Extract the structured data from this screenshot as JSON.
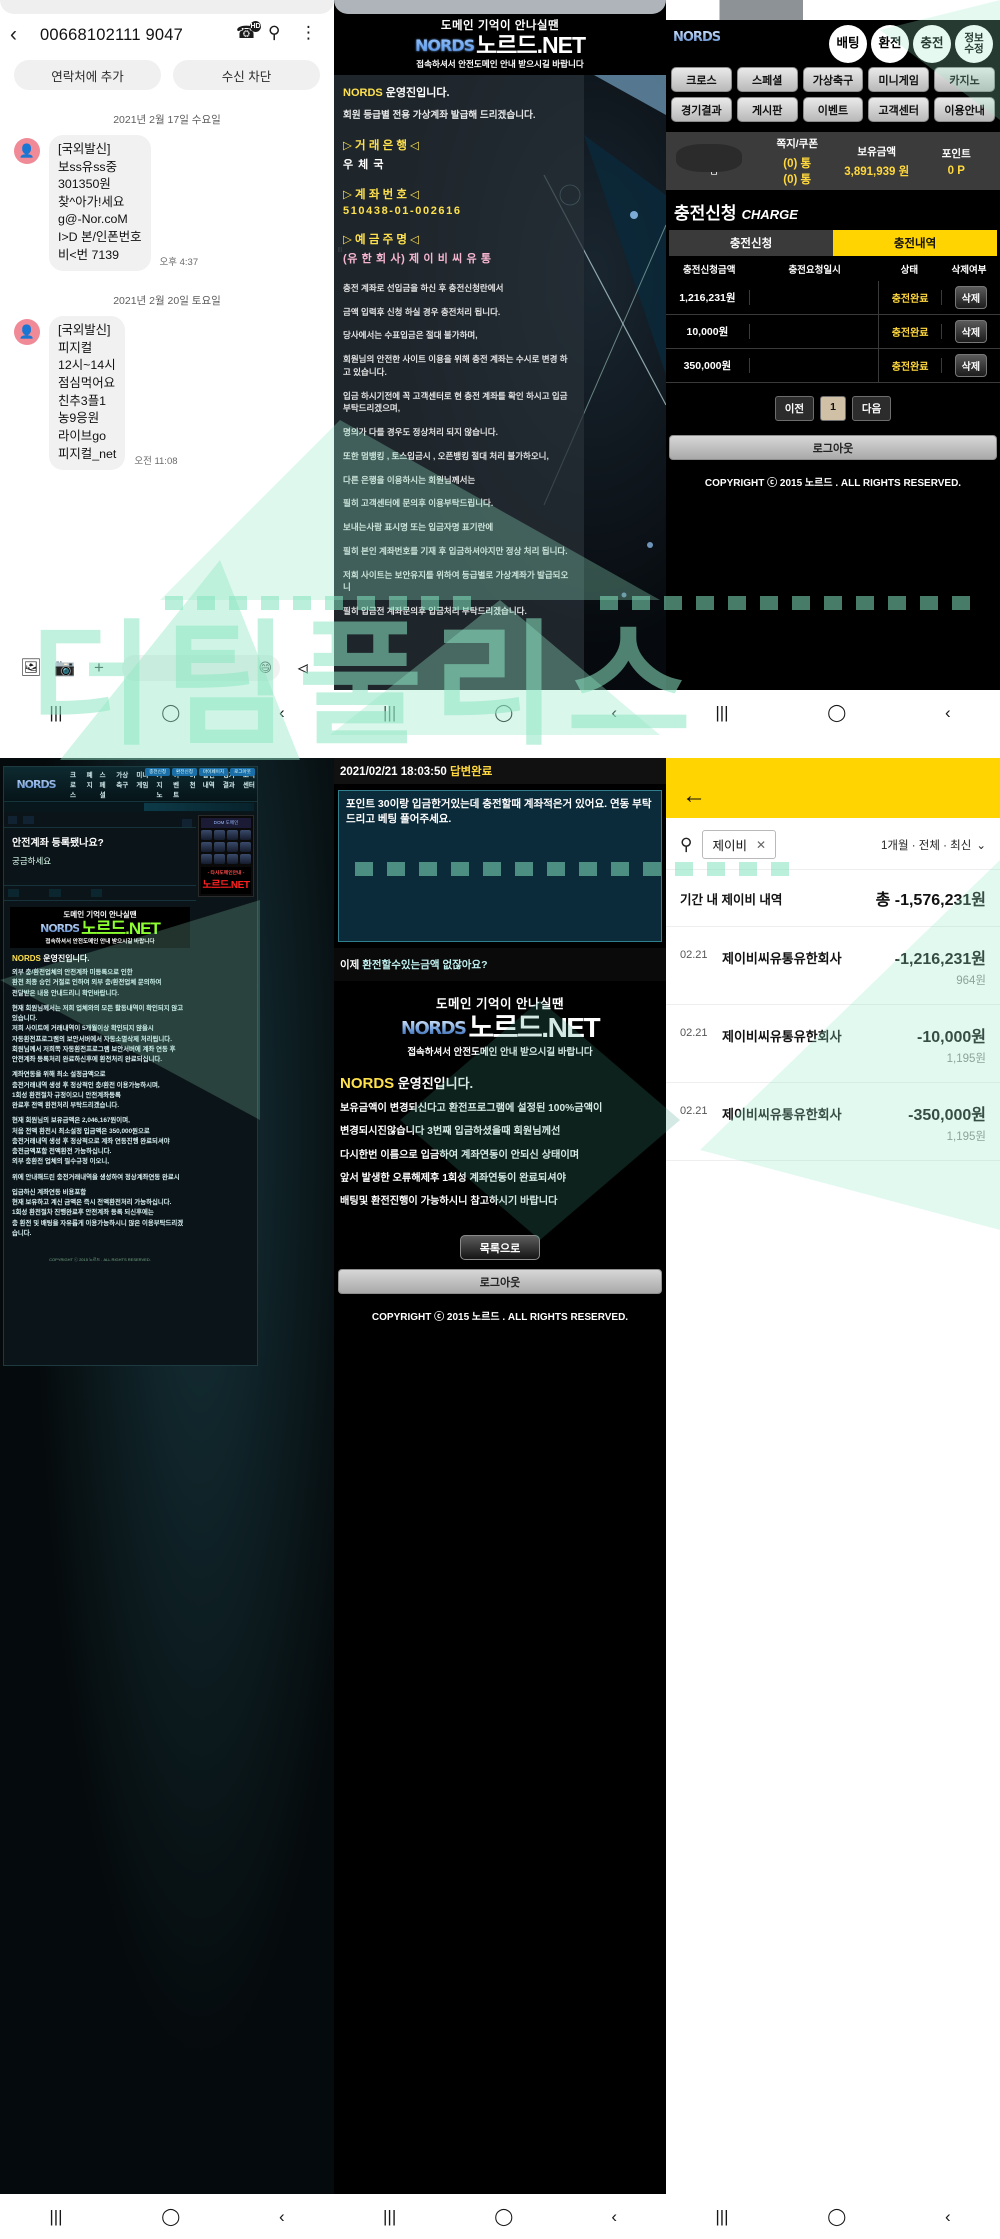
{
  "panel_sms": {
    "phone_number": "00668102111 9047",
    "call_icon": "call-hd-icon",
    "search_icon": "search-icon",
    "more_icon": "more-vertical-icon",
    "add_contact_label": "연락처에 추가",
    "block_label": "수신 차단",
    "date_1": "2021년 2월 17일 수요일",
    "date_2": "2021년 2월 20일 토요일",
    "message_1": "[국외발신]\n보ss유ss중\n301350원\n찾^아가!세요\ng@-Nor.coM\nI>D 본/인폰번호\n비<번 7139",
    "time_1": "오후 4:37",
    "message_2": "[국외발신]\n피지컬\n12시~14시\n점심먹어요\n친추3플1\n농9응원\n라이브go\n피지컬_net",
    "time_2": "오전 11:08",
    "footer_icons": [
      "image-icon",
      "camera-icon",
      "plus-icon",
      "sticker-icon",
      "voice-icon"
    ]
  },
  "panel_notice": {
    "banner_top": "도메인 기억이 안나실땐",
    "banner_logo": "NORDS",
    "banner_domain": "노르드.NET",
    "banner_bottom": "접속하셔서 안전도메인 안내 받으시길 바랍니다",
    "title_brand": "NORDS",
    "title_rest": " 운영진입니다.",
    "subtitle": "회원 등급별 전용 가상계좌 발급해 드리겠습니다.",
    "bank_label": "▷ 거 래 은 행 ◁",
    "bank_value": "우 체 국",
    "account_label": "▷ 계 좌 번 호 ◁",
    "account_value": "510438-01-002616",
    "holder_label": "▷ 예 금 주 명 ◁",
    "holder_value": "(유 한 회 사) 제 이 비 씨 유 통",
    "paragraphs": [
      "충전 계좌로 선입금을 하신 후 충전신청란에서",
      "금액 입력후 신청 하실 경우 충전처리 됩니다.",
      "당사에서는 수표입금은 절대 불가하며,",
      "회원님의 안전한 사이트 이용을 위해 충전 계좌는 수시로 변경 하고 있습니다.",
      "입금 하시기전에 꼭 고객센터로 현 충전 계좌를 확인 하시고 입금 부탁드리겠으며,",
      "명의가 다를 경우도 정상처리 되지 않습니다.",
      "또한 멈뱅킹 , 토스입금시 , 오픈뱅킹 절대 처리 불가하오니,",
      "다른 은행을 이용하시는 회원님께서는",
      "필히 고객센터에 문의후 이용부탁드립니다.",
      "보내는사람 표시명 또는 입금자명 표기란에",
      "필히 본인 계좌번호를 기재 후 입금하셔야지만 정상 처리 됩니다.",
      "저희 사이트는 보안유지를 위하여 등급별로 가상계좌가 발급되오니",
      "필히 입금전 계좌문의후 입금처리 부탁드리겠습니다."
    ]
  },
  "panel_charge": {
    "logo": "NORDS",
    "circle_buttons": [
      "배팅",
      "환전",
      "충전",
      "정보\n수정"
    ],
    "menu_row_1": [
      "크로스",
      "스페셜",
      "가상축구",
      "미니게임",
      "카지노"
    ],
    "menu_row_2": [
      "경기결과",
      "게시판",
      "이벤트",
      "고객센터",
      "이용안내"
    ],
    "user_suffix": "님",
    "info": [
      {
        "label": "쪽지/쿠폰",
        "value": "(0) 통\n(0) 통"
      },
      {
        "label": "보유금액",
        "value": "3,891,939 원"
      },
      {
        "label": "포인트",
        "value": "0 P"
      }
    ],
    "section_title_kr": "충전신청",
    "section_title_en": "CHARGE",
    "tab_request": "충전신청",
    "tab_history": "충전내역",
    "table_headers": [
      "충전신청금액",
      "충전요청일시",
      "상태",
      "삭제여부"
    ],
    "rows": [
      {
        "amount": "1,216,231원",
        "datetime": "",
        "status": "충전완료",
        "delete": "삭제"
      },
      {
        "amount": "10,000원",
        "datetime": "",
        "status": "충전완료",
        "delete": "삭제"
      },
      {
        "amount": "350,000원",
        "datetime": "",
        "status": "충전완료",
        "delete": "삭제"
      }
    ],
    "pager_prev": "이전",
    "pager_current": "1",
    "pager_next": "다음",
    "logout": "로그아웃",
    "copyright": "COPYRIGHT ⓒ 2015 노르드 . ALL RIGHTS RESERVED."
  },
  "panel_desktop": {
    "logo": "NORDS",
    "nav": [
      "크로스",
      "폐지",
      "스페셜",
      "가상축구",
      "미니게임",
      "카지노",
      "이벤트",
      "머천",
      "충전내역",
      "경기결과",
      "고객센터"
    ],
    "login_buttons": [
      "충전신청",
      "환전신청",
      "마이페이지",
      "로그아웃"
    ],
    "question_title": "안전계좌 등록됐나요?",
    "question_body": "궁금하세요",
    "banner_top": "도메인 기억이 안나실땐",
    "banner_logo": "NORDS",
    "banner_domain": "노르드.NET",
    "banner_bottom": "접속하셔서 안전도메인 안내 받으시길 바랍니다",
    "answer_brand": "NORDS",
    "answer_brand_rest": " 운영진입니다.",
    "answer_paragraphs": [
      "외부 충/환전업체의 안전계좌 미등록으로 인한\n환전 최종 승인 거절로 인하여 외부 충/환전업체 문의하여\n전달받은 내용 안내드리니 확인바랍니다.",
      "현재 회원님께서는 저희 업체와의 모든 활동내역이 확인되지 않고 있습니다.\n저희 사이트에 거래내역이 5개월이상 확인되지 않을시\n자동환전프로그램의 보안서버에서 자동소멸삭제 처리됩니다.\n회원님께서 저희쪽 자동환전프로그램 보안서버에 계좌 연동 후\n안전계좌 등록처리 완료하신후에 환전처리 완료되십니다.",
      "계좌연동을 위해 최소 설정금액으로\n충전거래내역 생성 후 정상적인 충/환전 이용가능하시며,\n1회성 환전절차 규정이오니 안전계좌등록\n완료후 전액 환전처리 부탁드리겠습니다.",
      "현재 회원님의 보유금액은 2,046,167원이며,\n처음 전액 환전시 최소설정 입금액은 350,000원으로\n충전거래내역 생성 후 정상적으로 계좌 연동진행 완료되셔야\n충전금액포함 전액환전 가능하십니다.\n외부 충환전 업체의 필수규정 이오니,",
      "위에 안내해드린 충전거래내역을 생성하여 정상계좌연동 완료시",
      "입금하신 계좌연동 비용포함\n현재 보유하고 계신 금액은 즉시 전액환전처리 가능하십니다.\n1회성 환전절차 진행완료후 안전계좌 등록 되신후에는\n충 환전 및 배팅을 자유롭게 이용가능하시니 많은 이용부탁드리겠습니다."
    ],
    "sidebar_header": "DOM 도메인",
    "sidebar_ad_top": "- 타사도메인안내 -",
    "sidebar_ad_domain": "노르드.NET",
    "footer": "COPYRIGHT ⓒ 2015 노르드 . ALL RIGHTS RESERVED."
  },
  "panel_qna": {
    "header_datetime": "2021/02/21 18:03:50",
    "header_status": "답변완료",
    "question": "포인트 30이랑 입금한거있는데 충전할때 계좌적은거 있어요. 연동 부탁드리고 베팅 풀어주세요.",
    "followup_prefix": "이제 ",
    "followup_hl": "환전할수있는금액 없잖아요?",
    "banner_top": "도메인 기억이 안나실땐",
    "banner_logo": "NORDS",
    "banner_domain": "노르드.NET",
    "banner_bottom": "접속하셔서 안전도메인 안내 받으시길 바랍니다",
    "answer_brand": "NORDS",
    "answer_brand_rest": " 운영진입니다.",
    "answer_lines": [
      "보유금액이 변경되신다고 환전프로그램에 설정된 100%금액이",
      "변경되시진않습니다 3번째 입금하셨을때 회원님께선",
      "다시한번 이름으로 입금하여 계좌연동이 안되신 상태이며",
      "앞서 발생한 오류해제후 1회성 계좌연동이 완료되셔야",
      "배팅및 환전진행이 가능하시니 참고하시기 바랍니다"
    ],
    "list_button": "목록으로",
    "logout": "로그아웃",
    "copyright": "COPYRIGHT ⓒ 2015 노르드 . ALL RIGHTS RESERVED."
  },
  "panel_bank": {
    "back_icon": "back-arrow-icon",
    "search_icon": "search-icon",
    "search_chip": "제이비",
    "chip_clear": "✕",
    "filter": "1개월 · 전체 · 최신",
    "filter_chevron": "⌄",
    "summary_label": "기간 내 제이비 내역",
    "summary_amount": "총 -1,576,231원",
    "transactions": [
      {
        "date": "02.21",
        "name": "제이비씨유통유한회사",
        "amount": "-1,216,231원",
        "balance": "964원"
      },
      {
        "date": "02.21",
        "name": "제이비씨유통유한회사",
        "amount": "-10,000원",
        "balance": "1,195원"
      },
      {
        "date": "02.21",
        "name": "제이비씨유통유한회사",
        "amount": "-350,000원",
        "balance": "1,195원"
      }
    ]
  },
  "navbar": {
    "recents": "|||",
    "home": "◯",
    "back": "‹"
  },
  "watermark": {
    "text": "더팀풀리스"
  }
}
